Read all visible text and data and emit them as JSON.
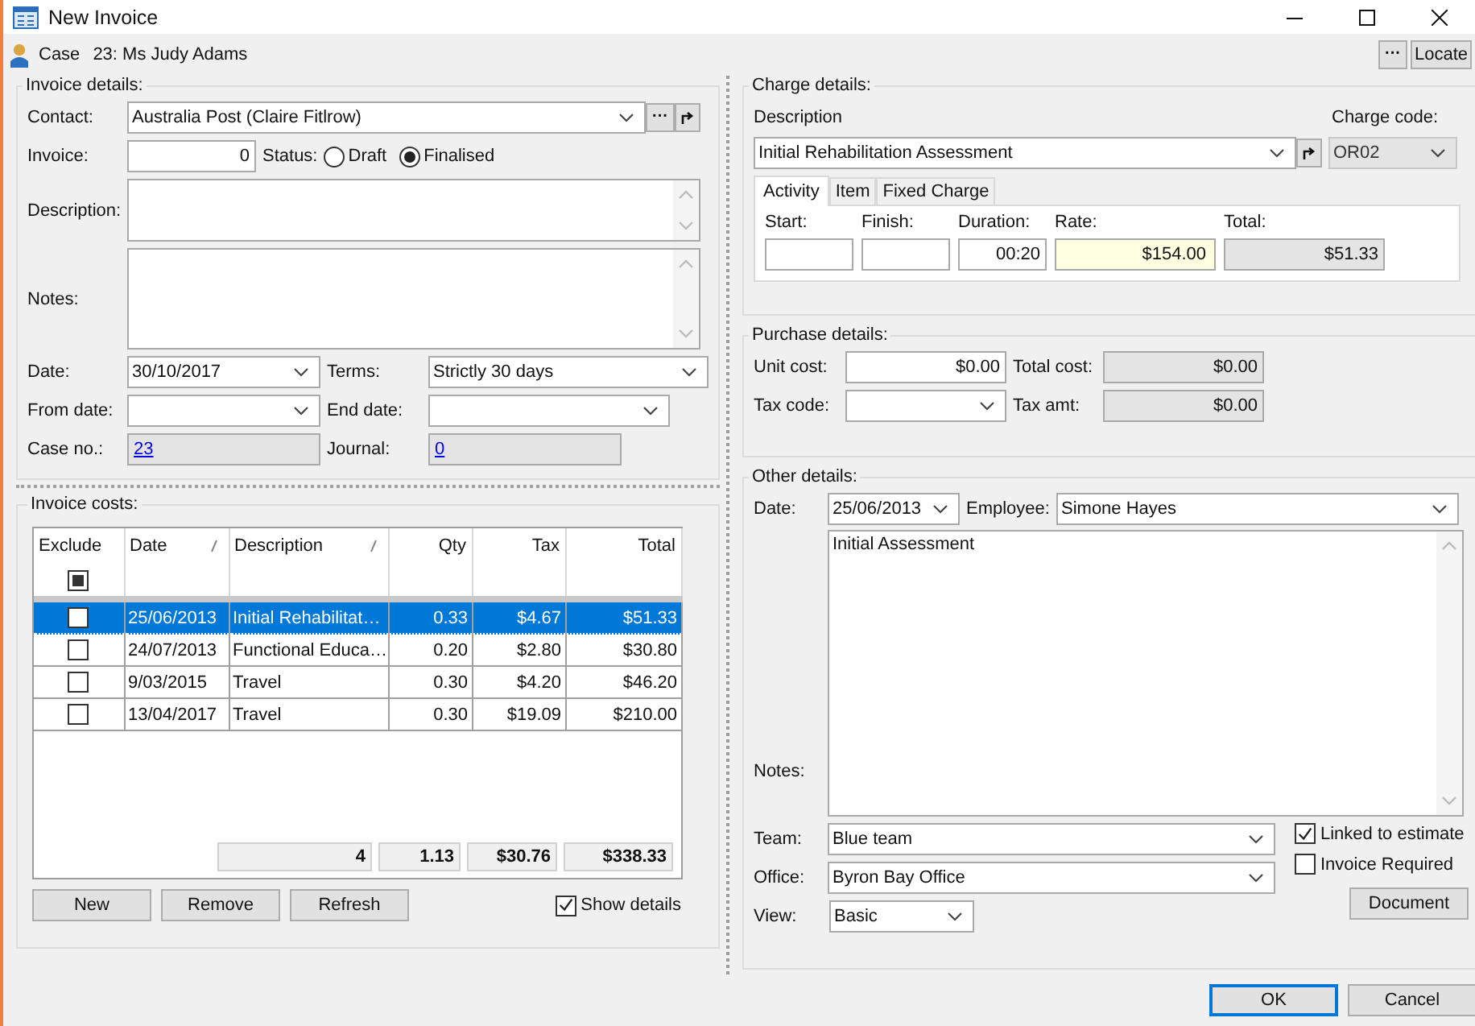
{
  "window": {
    "title": "New Invoice"
  },
  "case_bar": {
    "label": "Case",
    "value": "23: Ms Judy Adams",
    "more_button": "···",
    "locate_button": "Locate"
  },
  "invoice_details": {
    "title": "Invoice details:",
    "contact": {
      "label": "Contact:",
      "value": "Australia Post (Claire Fitlrow)",
      "more_button": "···"
    },
    "invoice": {
      "label": "Invoice:",
      "value": "0"
    },
    "status": {
      "label": "Status:",
      "options": [
        {
          "label": "Draft",
          "selected": false
        },
        {
          "label": "Finalised",
          "selected": true
        }
      ]
    },
    "description": {
      "label": "Description:"
    },
    "notes": {
      "label": "Notes:"
    },
    "date": {
      "label": "Date:",
      "value": "30/10/2017"
    },
    "terms": {
      "label": "Terms:",
      "value": "Strictly 30 days"
    },
    "from_date": {
      "label": "From date:"
    },
    "end_date": {
      "label": "End date:"
    },
    "case_no": {
      "label": "Case no.:",
      "value": "23"
    },
    "journal": {
      "label": "Journal:",
      "value": "0"
    }
  },
  "invoice_costs": {
    "title": "Invoice costs:",
    "columns": [
      {
        "label": "Exclude",
        "sortable": false
      },
      {
        "label": "Date",
        "sortable": true
      },
      {
        "label": "Description",
        "sortable": true
      },
      {
        "label": "Qty",
        "sortable": false
      },
      {
        "label": "Tax",
        "sortable": false
      },
      {
        "label": "Total",
        "sortable": false
      }
    ],
    "header_checkbox_indeterminate": true,
    "rows": [
      {
        "exclude": false,
        "selected": true,
        "date": "25/06/2013",
        "description": "Initial Rehabilitat…",
        "qty": "0.33",
        "tax": "$4.67",
        "total": "$51.33"
      },
      {
        "exclude": false,
        "selected": false,
        "date": "24/07/2013",
        "description": "Functional Educa…",
        "qty": "0.20",
        "tax": "$2.80",
        "total": "$30.80"
      },
      {
        "exclude": false,
        "selected": false,
        "date": "9/03/2015",
        "description": "Travel",
        "qty": "0.30",
        "tax": "$4.20",
        "total": "$46.20"
      },
      {
        "exclude": false,
        "selected": false,
        "date": "13/04/2017",
        "description": "Travel",
        "qty": "0.30",
        "tax": "$19.09",
        "total": "$210.00"
      }
    ],
    "totals": [
      "4",
      "1.13",
      "$30.76",
      "$338.33"
    ],
    "buttons": [
      "New",
      "Remove",
      "Refresh"
    ],
    "show_details": {
      "label": "Show details",
      "checked": true
    }
  },
  "charge_details": {
    "title": "Charge details:",
    "description": {
      "label": "Description",
      "value": "Initial Rehabilitation Assessment"
    },
    "charge_code": {
      "label": "Charge code:",
      "value": "OR02",
      "disabled": true
    },
    "tabs": [
      {
        "label": "Activity",
        "selected": true
      },
      {
        "label": "Item",
        "selected": false
      },
      {
        "label": "Fixed Charge",
        "selected": false
      }
    ],
    "fields": [
      {
        "label": "Start:",
        "kind": "input"
      },
      {
        "label": "Finish:",
        "kind": "input"
      },
      {
        "label": "Duration:",
        "value": "00:20",
        "kind": "input"
      },
      {
        "label": "Rate:",
        "value": "$154.00",
        "kind": "highlight"
      },
      {
        "label": "Total:",
        "value": "$51.33",
        "kind": "readonly"
      }
    ]
  },
  "purchase_details": {
    "title": "Purchase details:",
    "unit_cost": {
      "label": "Unit cost:",
      "value": "$0.00"
    },
    "total_cost": {
      "label": "Total cost:",
      "value": "$0.00"
    },
    "tax_code": {
      "label": "Tax code:"
    },
    "tax_amt": {
      "label": "Tax amt:",
      "value": "$0.00"
    }
  },
  "other_details": {
    "title": "Other details:",
    "date": {
      "label": "Date:",
      "value": "25/06/2013"
    },
    "employee": {
      "label": "Employee:",
      "value": "Simone Hayes"
    },
    "notes": {
      "label": "Notes:",
      "value": "Initial Assessment"
    },
    "team": {
      "label": "Team:",
      "value": "Blue team"
    },
    "office": {
      "label": "Office:",
      "value": "Byron Bay Office"
    },
    "view": {
      "label": "View:",
      "value": "Basic"
    },
    "linked_to_estimate": {
      "label": "Linked to estimate",
      "checked": true
    },
    "invoice_required": {
      "label": "Invoice Required",
      "checked": false
    },
    "document_button": "Document"
  },
  "buttons": [
    {
      "label": "OK",
      "default": true
    },
    {
      "label": "Cancel",
      "default": false
    }
  ]
}
